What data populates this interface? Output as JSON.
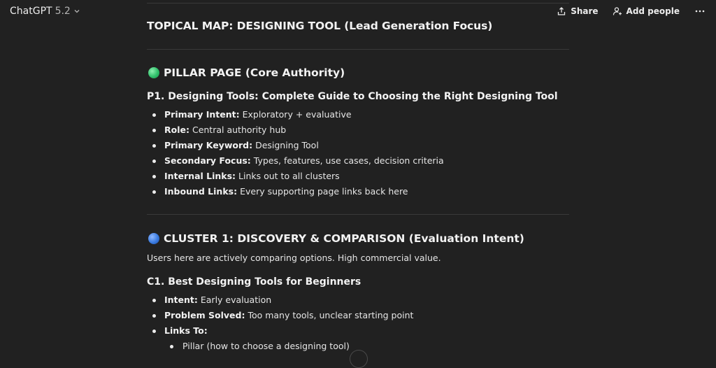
{
  "header": {
    "model_name": "ChatGPT",
    "model_version": "5.2",
    "share_label": "Share",
    "add_people_label": "Add people"
  },
  "doc": {
    "title": "TOPICAL MAP: DESIGNING TOOL (Lead Generation Focus)",
    "pillar": {
      "heading": "PILLAR PAGE (Core Authority)",
      "page_title": "P1. Designing Tools: Complete Guide to Choosing the Right Designing Tool",
      "items": [
        {
          "key": "Primary Intent:",
          "value": "Exploratory + evaluative"
        },
        {
          "key": "Role:",
          "value": "Central authority hub"
        },
        {
          "key": "Primary Keyword:",
          "value": "Designing Tool"
        },
        {
          "key": "Secondary Focus:",
          "value": "Types, features, use cases, decision criteria"
        },
        {
          "key": "Internal Links:",
          "value": "Links out to all clusters"
        },
        {
          "key": "Inbound Links:",
          "value": "Every supporting page links back here"
        }
      ]
    },
    "cluster1": {
      "heading": "CLUSTER 1: DISCOVERY & COMPARISON (Evaluation Intent)",
      "intro": "Users here are actively comparing options. High commercial value.",
      "page_title": "C1. Best Designing Tools for Beginners",
      "items": [
        {
          "key": "Intent:",
          "value": "Early evaluation"
        },
        {
          "key": "Problem Solved:",
          "value": "Too many tools, unclear starting point"
        },
        {
          "key": "Links To:",
          "value": ""
        }
      ],
      "nested": [
        "Pillar (how to choose a designing tool)"
      ]
    }
  },
  "icons": {
    "chevron": "chevron-down-icon",
    "share": "share-icon",
    "add_people": "add-person-icon",
    "more": "more-horizontal-icon",
    "pillar_dot": "green-circle-icon",
    "cluster_dot": "blue-circle-icon"
  },
  "colors": {
    "background": "#212121",
    "text": "#ececec",
    "green_dot": "#2fbf6a",
    "blue_dot": "#3a7be0"
  }
}
